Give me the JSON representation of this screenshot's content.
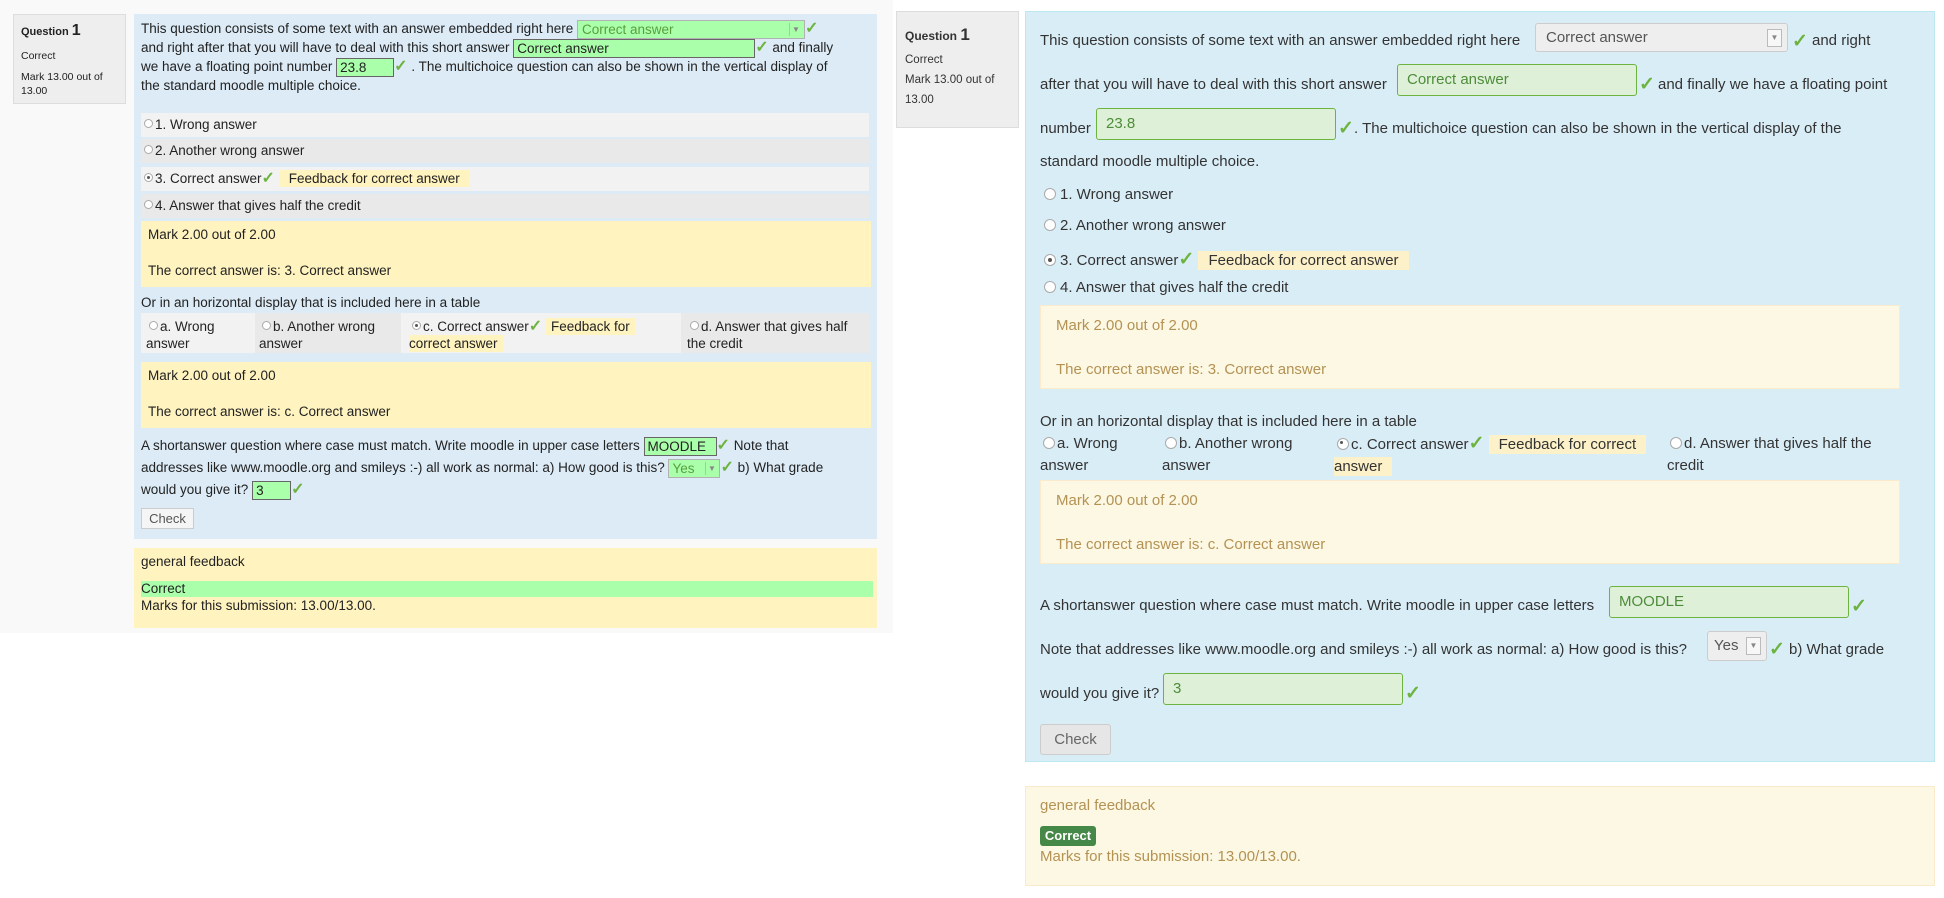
{
  "question": {
    "heading": "Question",
    "number": "1",
    "state": "Correct",
    "mark_left": "Mark 13.00 out of 13.00",
    "mark_right": "Mark 13.00 out of 13.00"
  },
  "embedded": {
    "text1": "This question consists of some text with an answer embedded right here",
    "dropdown_value": "Correct answer",
    "text2": "and right after that you will have to deal with this short answer",
    "short_value": "Correct answer",
    "text3": "and finally we have a floating point number",
    "number_value": "23.8",
    "text4": ". The multichoice question can also be shown in the vertical display of the standard moodle multiple choice.",
    "right_text2a": "and right",
    "right_text2b": "after that you will have to deal with this short answer",
    "right_text3a": "and finally we have a floating point",
    "right_text3b": "number",
    "right_text4a": ". The multichoice question can also be shown in the vertical display of the",
    "right_text4b": "standard moodle multiple choice."
  },
  "vertical_options": [
    {
      "label": "1. Wrong answer",
      "selected": false,
      "feedback": ""
    },
    {
      "label": "2. Another wrong answer",
      "selected": false,
      "feedback": ""
    },
    {
      "label": "3. Correct answer",
      "selected": true,
      "feedback": "Feedback for correct answer"
    },
    {
      "label": "4. Answer that gives half the credit",
      "selected": false,
      "feedback": ""
    }
  ],
  "vertical_outcome": {
    "mark": "Mark 2.00 out of 2.00",
    "right_answer": "The correct answer is: 3. Correct answer"
  },
  "horizontal_intro": "Or in an horizontal display that is included here in a table",
  "horizontal_options": [
    {
      "label_a": "a. Wrong",
      "label_b": "answer",
      "selected": false,
      "feedback": ""
    },
    {
      "label_a": "b. Another wrong",
      "label_b": "answer",
      "selected": false,
      "feedback": ""
    },
    {
      "label_a": "c. Correct answer",
      "label_b": "",
      "selected": true,
      "feedback": "Feedback for correct answer"
    },
    {
      "label_a": "d. Answer that gives half",
      "label_b": "the credit",
      "selected": false,
      "feedback": ""
    }
  ],
  "horizontal_right": {
    "a1": "a. Wrong",
    "a2": "answer",
    "b1": "b. Another wrong",
    "b2": "answer",
    "c1": "c. Correct answer",
    "fb1": "Feedback for correct",
    "fb2": "answer",
    "d1": "d. Answer that gives half the",
    "d2": "credit"
  },
  "horizontal_left": {
    "fb1": "Feedback for",
    "fb2": "correct answer"
  },
  "horizontal_outcome": {
    "mark": "Mark 2.00 out of 2.00",
    "right_answer": "The correct answer is: c. Correct answer"
  },
  "shortanswer": {
    "text1": "A shortanswer question where case must match. Write moodle in upper case letters",
    "value": "MOODLE",
    "text2": "Note that addresses like www.moodle.org and smileys :-) all work as normal: a) How good is this?",
    "left_text2a": "Note that",
    "left_text2b": "addresses like www.moodle.org and smileys :-) all work as normal: a) How good is this?",
    "yes_value": "Yes",
    "text3": "b) What grade",
    "text4": "would you give it?",
    "grade_value": "3"
  },
  "check_button": "Check",
  "general_feedback": {
    "title": "general feedback",
    "state": "Correct",
    "marks": "Marks for this submission: 13.00/13.00."
  },
  "colors": {
    "correct_green": "#aaffaa",
    "check_mark": "#6db33f",
    "feedback_yellow": "#fff3bf",
    "info_blue": "#d9edf7",
    "badge_green": "#468847"
  }
}
